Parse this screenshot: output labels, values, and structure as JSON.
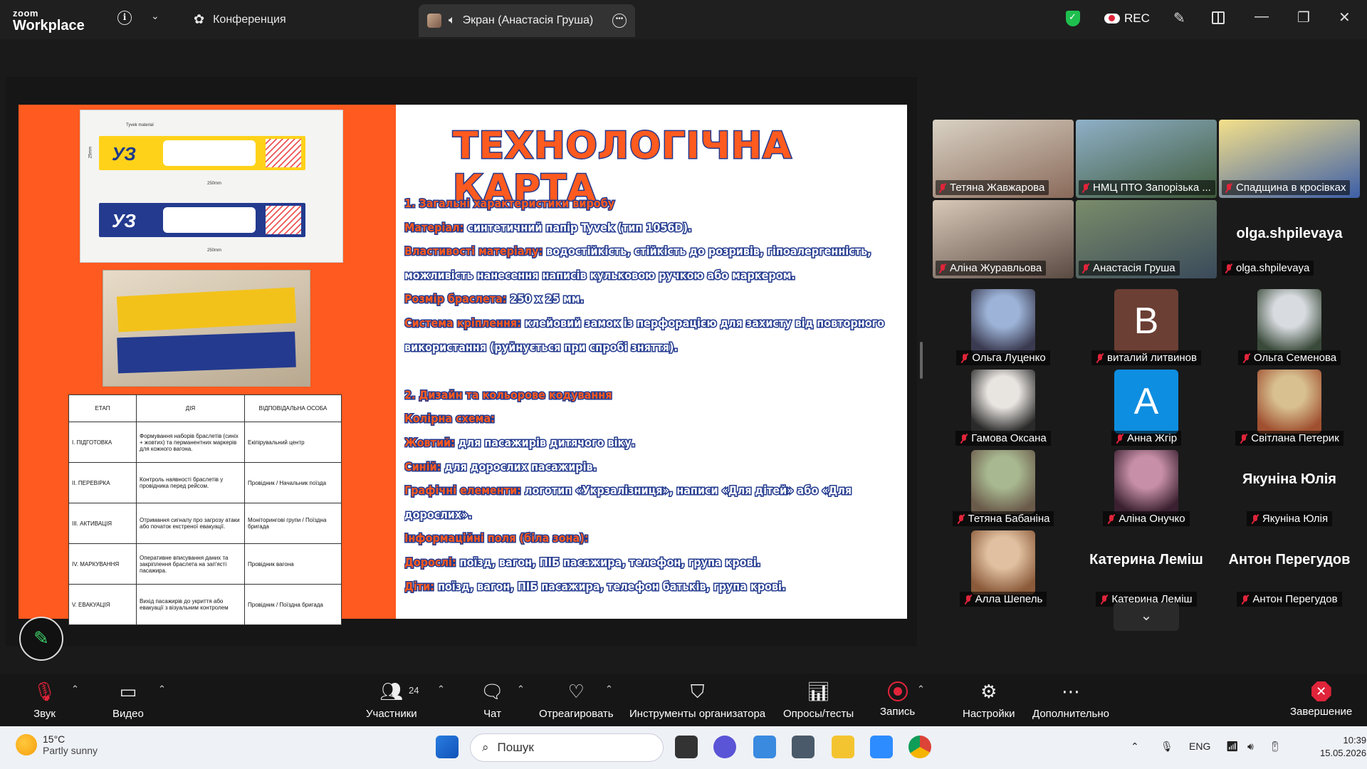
{
  "titlebar": {
    "brand_top": "zoom",
    "brand_bottom": "Workplace",
    "conference_tab": "Конференция",
    "screen_tab": "Экран (Анастасія Груша)",
    "rec_label": "REC"
  },
  "slide": {
    "title": "ТЕХНОЛОГІЧНА КАРТА",
    "lines": [
      {
        "k": "1. Загальні характеристики виробу",
        "v": "",
        "type": "head"
      },
      {
        "k": "Матеріал:",
        "v": " синтетичний папір Tyvek (тип 1056D)."
      },
      {
        "k": "Властивості матеріалу:",
        "v": " водостійкість, стійкість до розривів, гіпоалергенність,"
      },
      {
        "k": "",
        "v": "можливість нанесення написів кульковою ручкою або маркером."
      },
      {
        "k": "Розмір браслета:",
        "v": " 250 x 25 мм."
      },
      {
        "k": "Система кріплення:",
        "v": " клейовий замок із перфорацією для захисту від повторного"
      },
      {
        "k": "",
        "v": "використання (руйнується при спробі зняття)."
      },
      {
        "k": "",
        "v": "",
        "type": "blank"
      },
      {
        "k": "2. Дизайн та кольорове кодування",
        "v": "",
        "type": "head"
      },
      {
        "k": "Колірна схема:",
        "v": ""
      },
      {
        "k": "Жовтий:",
        "v": " для пасажирів дитячого віку."
      },
      {
        "k": "Синій:",
        "v": " для дорослих пасажирів."
      },
      {
        "k": "Графічні елементи:",
        "v": " логотип «Укрзалізниця», написи «Для дітей» або «Для"
      },
      {
        "k": "",
        "v": "дорослих»."
      },
      {
        "k": "Інформаційні поля (біла зона):",
        "v": ""
      },
      {
        "k": "Дорослі:",
        "v": " поїзд, вагон, ПІБ пасажира, телефон, група крові."
      },
      {
        "k": "Діти:",
        "v": " поїзд, вагон, ПІБ пасажира, телефон батьків, група крові."
      }
    ],
    "diagram": {
      "logo": "УЗ",
      "label_material": "Tyvek material",
      "dim_width": "250mm",
      "dim_height": "25mm"
    },
    "table": {
      "headers": [
        "ЕТАП",
        "ДІЯ",
        "ВІДПОВІДАЛЬНА ОСОБА"
      ],
      "rows": [
        [
          "I. ПІДГОТОВКА",
          "Формування наборів браслетів (синіх + жовтих) та перманентних маркерів для кожного вагона.",
          "Екіпірувальний центр"
        ],
        [
          "II. ПЕРЕВІРКА",
          "Контроль наявності браслетів у провідника перед рейсом.",
          "Провідник / Начальник поїзда"
        ],
        [
          "III. АКТИВАЦІЯ",
          "Отримання сигналу про загрозу атаки або початок екстреної евакуації.",
          "Моніторингові групи / Поїздна бригада"
        ],
        [
          "IV. МАРКУВАННЯ",
          "Оперативне вписування даних та закріплення браслета на зап'ясті пасажира.",
          "Провідник вагона"
        ],
        [
          "V. ЕВАКУАЦІЯ",
          "Вихід пасажирів до укриття або евакуації з візуальним контролем",
          "Провідник / Поїздна бригада"
        ]
      ]
    }
  },
  "gallery": {
    "video": [
      {
        "name": "Тетяна Жавжарова",
        "colors": [
          "#d9d2c4",
          "#8a6a5a"
        ]
      },
      {
        "name": "НМЦ ПТО Запорізька ...",
        "colors": [
          "#8fb0c8",
          "#3f5a3a"
        ]
      },
      {
        "name": "Спадщина в кросівках",
        "colors": [
          "#f4e08a",
          "#3d5fa8"
        ]
      },
      {
        "name": "Аліна Журавльова",
        "colors": [
          "#d8c8b8",
          "#5a4a42"
        ]
      },
      {
        "name": "Анастасія Груша",
        "colors": [
          "#7a8c6a",
          "#3a4a5a"
        ],
        "active": true
      },
      {
        "name": "olga.shpilevaya",
        "colors": [
          "#1a1a1a",
          "#1a1a1a"
        ],
        "big": "olga.shpilevaya"
      }
    ],
    "avatars": [
      {
        "name": "Ольга Луценко",
        "colors": [
          "#9db4d8",
          "#3a3a50"
        ]
      },
      {
        "name": "виталий литвинов",
        "letter": "B",
        "color": "#6b3f34"
      },
      {
        "name": "Ольга Семенова",
        "colors": [
          "#d8dce0",
          "#3a4a3a"
        ]
      },
      {
        "name": "Гамова Оксана",
        "colors": [
          "#e8e4e0",
          "#2a2a2a"
        ]
      },
      {
        "name": "Анна Жгір",
        "letter": "A",
        "color": "#0e8ee0"
      },
      {
        "name": "Світлана Петерик",
        "colors": [
          "#d8c090",
          "#a05030"
        ]
      },
      {
        "name": "Тетяна Бабаніна",
        "colors": [
          "#a8b890",
          "#6a5a4a"
        ]
      },
      {
        "name": "Аліна Онучко",
        "colors": [
          "#c890a8",
          "#3a2030"
        ]
      },
      {
        "name": "Якуніна Юлія",
        "big": "Якуніна Юлія"
      },
      {
        "name": "Алла Шепель",
        "colors": [
          "#e0c0a0",
          "#8a5a3a"
        ]
      },
      {
        "name": "Катерина Леміш",
        "big": "Катерина Леміш"
      },
      {
        "name": "Антон Перегудов",
        "big": "Антон Перегудов"
      }
    ]
  },
  "toolbar": {
    "audio": "Звук",
    "video": "Видео",
    "participants": "Участники",
    "participants_count": "24",
    "chat": "Чат",
    "react": "Отреагировать",
    "host_tools": "Инструменты организатора",
    "polls": "Опросы/тесты",
    "record": "Запись",
    "settings": "Настройки",
    "more": "Дополнительно",
    "end": "Завершение"
  },
  "taskbar": {
    "temp": "15°C",
    "weather": "Partly sunny",
    "search_placeholder": "Пошук",
    "lang": "ENG",
    "time": "10:39",
    "date": "15.05.2026"
  }
}
